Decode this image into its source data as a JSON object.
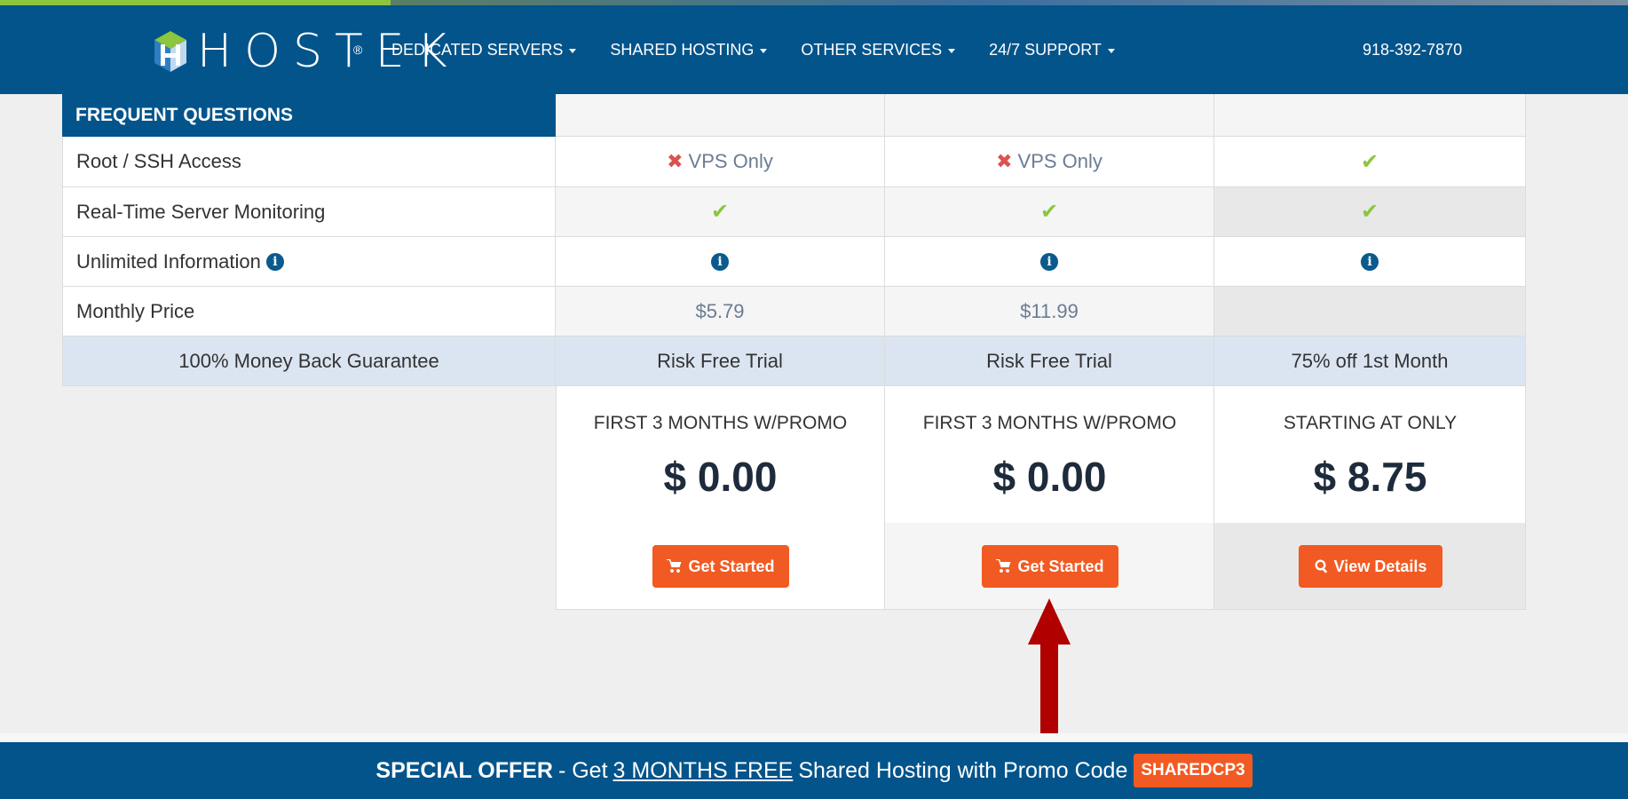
{
  "header": {
    "logo_text": "HOSTEK",
    "logo_reg": "®",
    "nav": [
      {
        "label": "DEDICATED SERVERS"
      },
      {
        "label": "SHARED HOSTING"
      },
      {
        "label": "OTHER SERVICES"
      },
      {
        "label": "24/7 SUPPORT"
      }
    ],
    "phone": "918-392-7870"
  },
  "table": {
    "section_title": "FREQUENT QUESTIONS",
    "rows": [
      {
        "label": "Root / SSH Access",
        "cells": [
          {
            "icon": "x",
            "text": "VPS Only"
          },
          {
            "icon": "x",
            "text": "VPS Only"
          },
          {
            "icon": "check",
            "text": ""
          }
        ]
      },
      {
        "label": "Real-Time Server Monitoring",
        "cells": [
          {
            "icon": "check",
            "text": ""
          },
          {
            "icon": "check",
            "text": ""
          },
          {
            "icon": "check",
            "text": ""
          }
        ]
      },
      {
        "label": "Unlimited Information",
        "cells": [
          {
            "icon": "info",
            "text": ""
          },
          {
            "icon": "info",
            "text": ""
          },
          {
            "icon": "info",
            "text": ""
          }
        ]
      },
      {
        "label": "Monthly Price",
        "cells": [
          {
            "text": "$5.79"
          },
          {
            "text": "$11.99"
          },
          {
            "text": ""
          }
        ]
      }
    ],
    "guarantee": {
      "label": "100% Money Back Guarantee",
      "cells": [
        "Risk Free Trial",
        "Risk Free Trial",
        "75% off 1st Month"
      ]
    },
    "plans": [
      {
        "promo_label": "FIRST 3 MONTHS W/PROMO",
        "price": "$ 0.00",
        "button": "Get Started"
      },
      {
        "promo_label": "FIRST 3 MONTHS W/PROMO",
        "price": "$ 0.00",
        "button": "Get Started"
      },
      {
        "promo_label": "STARTING AT ONLY",
        "price": "$ 8.75",
        "button": "View Details"
      }
    ]
  },
  "footer": {
    "offer_strong": "SPECIAL OFFER",
    "offer_pre": " - Get",
    "offer_link": "3 MONTHS FREE",
    "offer_post": "Shared Hosting with Promo Code",
    "promo_code": "SHAREDCP3"
  },
  "colors": {
    "brand_blue": "#03548b",
    "accent_orange": "#f15a22",
    "check_green": "#8cc63f",
    "x_red": "#d9534f",
    "annotation_arrow": "#b10000"
  }
}
